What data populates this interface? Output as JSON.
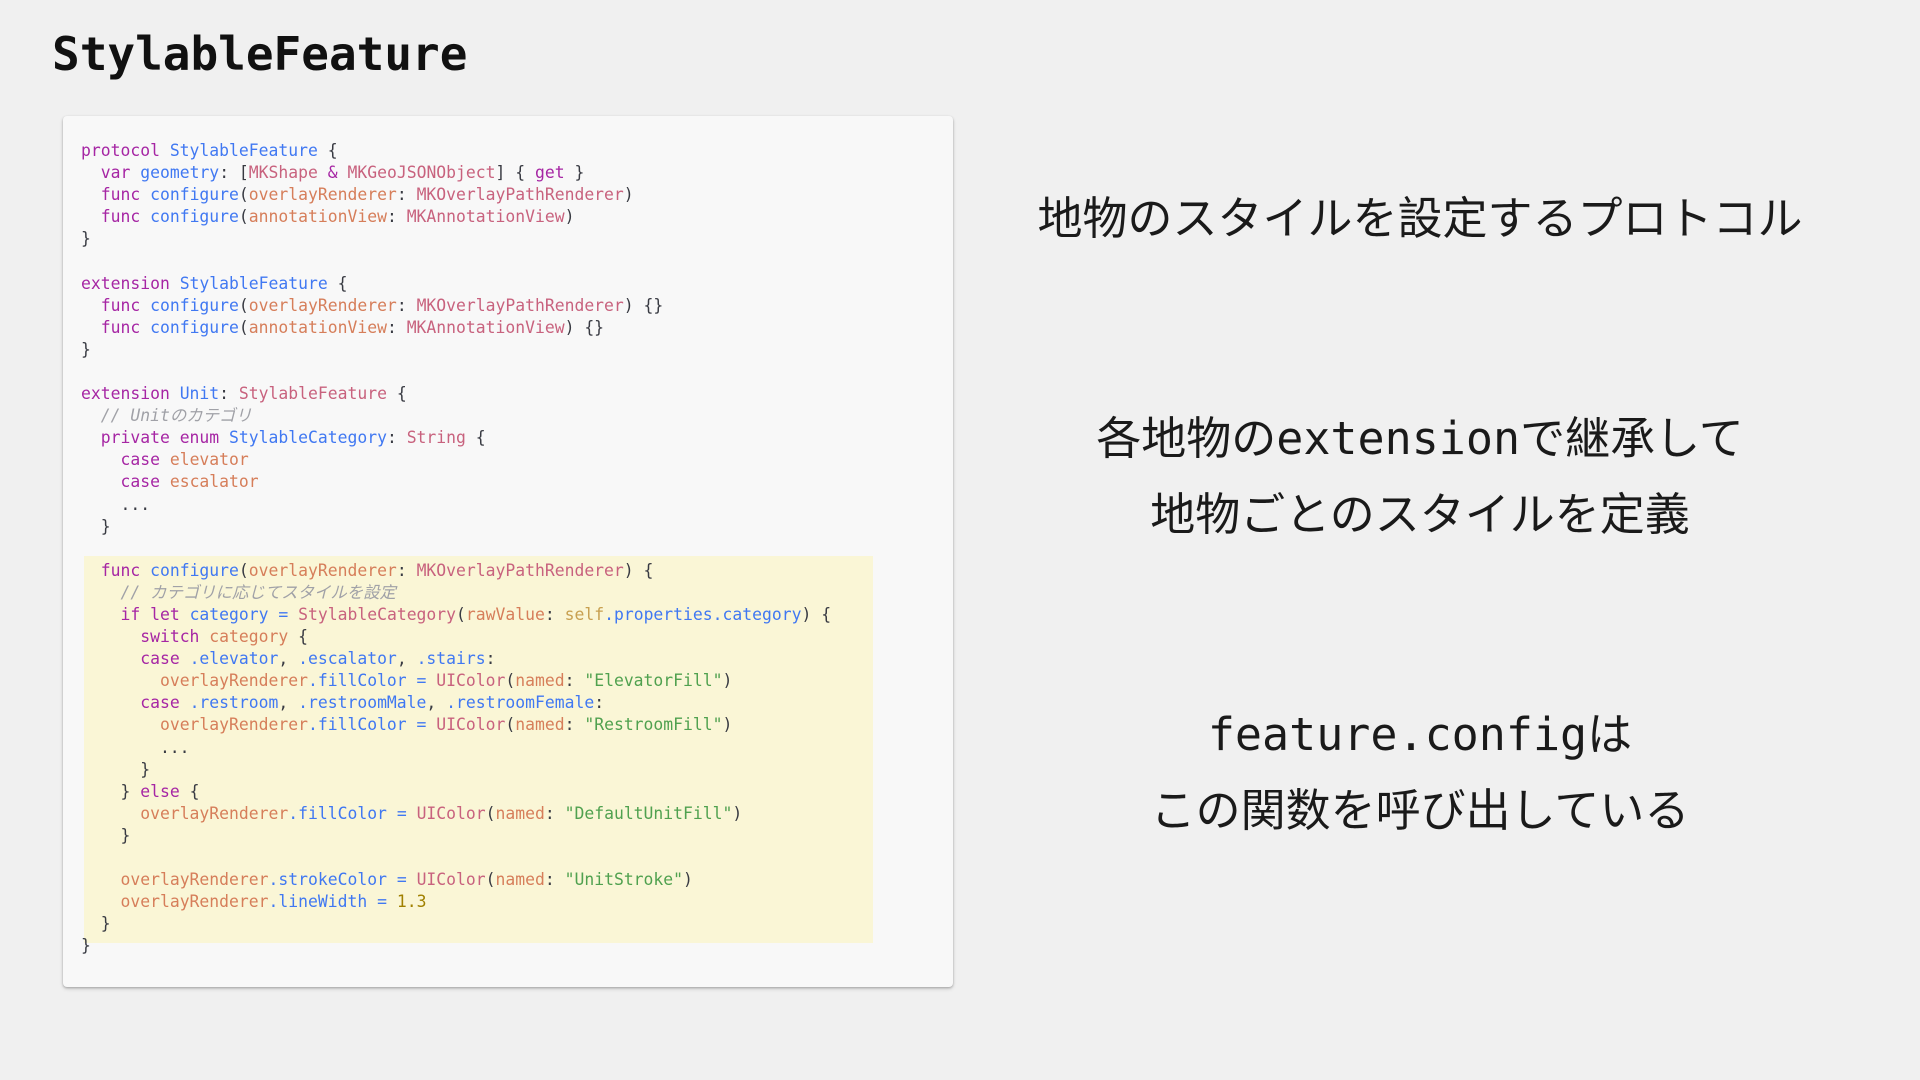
{
  "slide": {
    "title": "StylableFeature"
  },
  "captions": {
    "protocol": "地物のスタイルを設定するプロトコル",
    "extension_line1_code": "各地物のextensionで継承して",
    "extension_line2": "地物ごとのスタイルを定義",
    "config_line1_code": "feature.config",
    "config_line1_suffix": "は",
    "config_line2": "この関数を呼び出している"
  },
  "code": {
    "language": "swift",
    "highlighted_lines": "func configure(overlayRenderer:) block",
    "lines": [
      [
        [
          "kw",
          "protocol "
        ],
        [
          "fn",
          "StylableFeature"
        ],
        [
          "pl",
          " {"
        ]
      ],
      [
        [
          "pl",
          "  "
        ],
        [
          "kw",
          "var "
        ],
        [
          "fn",
          "geometry"
        ],
        [
          "pl",
          ": ["
        ],
        [
          "ty",
          "MKShape"
        ],
        [
          "pl",
          " "
        ],
        [
          "kw",
          "&"
        ],
        [
          "pl",
          " "
        ],
        [
          "ty",
          "MKGeoJSONObject"
        ],
        [
          "pl",
          "] { "
        ],
        [
          "kw",
          "get"
        ],
        [
          "pl",
          " }"
        ]
      ],
      [
        [
          "pl",
          "  "
        ],
        [
          "kw",
          "func "
        ],
        [
          "fn",
          "configure"
        ],
        [
          "pl",
          "("
        ],
        [
          "pr",
          "overlayRenderer"
        ],
        [
          "pl",
          ": "
        ],
        [
          "ty",
          "MKOverlayPathRenderer"
        ],
        [
          "pl",
          ")"
        ]
      ],
      [
        [
          "pl",
          "  "
        ],
        [
          "kw",
          "func "
        ],
        [
          "fn",
          "configure"
        ],
        [
          "pl",
          "("
        ],
        [
          "pr",
          "annotationView"
        ],
        [
          "pl",
          ": "
        ],
        [
          "ty",
          "MKAnnotationView"
        ],
        [
          "pl",
          ")"
        ]
      ],
      [
        [
          "pl",
          "}"
        ]
      ],
      [],
      [
        [
          "kw",
          "extension "
        ],
        [
          "fn",
          "StylableFeature"
        ],
        [
          "pl",
          " {"
        ]
      ],
      [
        [
          "pl",
          "  "
        ],
        [
          "kw",
          "func "
        ],
        [
          "fn",
          "configure"
        ],
        [
          "pl",
          "("
        ],
        [
          "pr",
          "overlayRenderer"
        ],
        [
          "pl",
          ": "
        ],
        [
          "ty",
          "MKOverlayPathRenderer"
        ],
        [
          "pl",
          ") {}"
        ]
      ],
      [
        [
          "pl",
          "  "
        ],
        [
          "kw",
          "func "
        ],
        [
          "fn",
          "configure"
        ],
        [
          "pl",
          "("
        ],
        [
          "pr",
          "annotationView"
        ],
        [
          "pl",
          ": "
        ],
        [
          "ty",
          "MKAnnotationView"
        ],
        [
          "pl",
          ") {}"
        ]
      ],
      [
        [
          "pl",
          "}"
        ]
      ],
      [],
      [
        [
          "kw",
          "extension "
        ],
        [
          "fn",
          "Unit"
        ],
        [
          "pl",
          ": "
        ],
        [
          "ty",
          "StylableFeature"
        ],
        [
          "pl",
          " {"
        ]
      ],
      [
        [
          "pl",
          "  "
        ],
        [
          "cm",
          "// Unitのカテゴリ"
        ]
      ],
      [
        [
          "pl",
          "  "
        ],
        [
          "kw",
          "private enum "
        ],
        [
          "fn",
          "StylableCategory"
        ],
        [
          "pl",
          ": "
        ],
        [
          "ty",
          "String"
        ],
        [
          "pl",
          " {"
        ]
      ],
      [
        [
          "pl",
          "    "
        ],
        [
          "kw",
          "case "
        ],
        [
          "pr",
          "elevator"
        ]
      ],
      [
        [
          "pl",
          "    "
        ],
        [
          "kw",
          "case "
        ],
        [
          "pr",
          "escalator"
        ]
      ],
      [
        [
          "pl",
          "    ..."
        ]
      ],
      [
        [
          "pl",
          "  }"
        ]
      ],
      [],
      [
        [
          "pl",
          "  "
        ],
        [
          "kw",
          "func "
        ],
        [
          "fn",
          "configure"
        ],
        [
          "pl",
          "("
        ],
        [
          "pr",
          "overlayRenderer"
        ],
        [
          "pl",
          ": "
        ],
        [
          "ty",
          "MKOverlayPathRenderer"
        ],
        [
          "pl",
          ") {"
        ]
      ],
      [
        [
          "pl",
          "    "
        ],
        [
          "cm",
          "// カテゴリに応じてスタイルを設定"
        ]
      ],
      [
        [
          "pl",
          "    "
        ],
        [
          "kw",
          "if let "
        ],
        [
          "fn",
          "category"
        ],
        [
          "pl",
          " "
        ],
        [
          "mb",
          "="
        ],
        [
          "pl",
          " "
        ],
        [
          "ty",
          "StylableCategory"
        ],
        [
          "pl",
          "("
        ],
        [
          "pr",
          "rawValue"
        ],
        [
          "pl",
          ": "
        ],
        [
          "sf",
          "self"
        ],
        [
          "mb",
          ".properties.category"
        ],
        [
          "pl",
          ") {"
        ]
      ],
      [
        [
          "pl",
          "      "
        ],
        [
          "kw",
          "switch "
        ],
        [
          "pr",
          "category"
        ],
        [
          "pl",
          " {"
        ]
      ],
      [
        [
          "pl",
          "      "
        ],
        [
          "kw",
          "case "
        ],
        [
          "mb",
          ".elevator"
        ],
        [
          "pl",
          ", "
        ],
        [
          "mb",
          ".escalator"
        ],
        [
          "pl",
          ", "
        ],
        [
          "mb",
          ".stairs"
        ],
        [
          "pl",
          ":"
        ]
      ],
      [
        [
          "pl",
          "        "
        ],
        [
          "pr",
          "overlayRenderer"
        ],
        [
          "mb",
          ".fillColor"
        ],
        [
          "pl",
          " "
        ],
        [
          "mb",
          "="
        ],
        [
          "pl",
          " "
        ],
        [
          "ty",
          "UIColor"
        ],
        [
          "pl",
          "("
        ],
        [
          "pr",
          "named"
        ],
        [
          "pl",
          ": "
        ],
        [
          "st",
          "\"ElevatorFill\""
        ],
        [
          "pl",
          ")"
        ]
      ],
      [
        [
          "pl",
          "      "
        ],
        [
          "kw",
          "case "
        ],
        [
          "mb",
          ".restroom"
        ],
        [
          "pl",
          ", "
        ],
        [
          "mb",
          ".restroomMale"
        ],
        [
          "pl",
          ", "
        ],
        [
          "mb",
          ".restroomFemale"
        ],
        [
          "pl",
          ":"
        ]
      ],
      [
        [
          "pl",
          "        "
        ],
        [
          "pr",
          "overlayRenderer"
        ],
        [
          "mb",
          ".fillColor"
        ],
        [
          "pl",
          " "
        ],
        [
          "mb",
          "="
        ],
        [
          "pl",
          " "
        ],
        [
          "ty",
          "UIColor"
        ],
        [
          "pl",
          "("
        ],
        [
          "pr",
          "named"
        ],
        [
          "pl",
          ": "
        ],
        [
          "st",
          "\"RestroomFill\""
        ],
        [
          "pl",
          ")"
        ]
      ],
      [
        [
          "pl",
          "        ..."
        ]
      ],
      [
        [
          "pl",
          "      }"
        ]
      ],
      [
        [
          "pl",
          "    } "
        ],
        [
          "kw",
          "else"
        ],
        [
          "pl",
          " {"
        ]
      ],
      [
        [
          "pl",
          "      "
        ],
        [
          "pr",
          "overlayRenderer"
        ],
        [
          "mb",
          ".fillColor"
        ],
        [
          "pl",
          " "
        ],
        [
          "mb",
          "="
        ],
        [
          "pl",
          " "
        ],
        [
          "ty",
          "UIColor"
        ],
        [
          "pl",
          "("
        ],
        [
          "pr",
          "named"
        ],
        [
          "pl",
          ": "
        ],
        [
          "st",
          "\"DefaultUnitFill\""
        ],
        [
          "pl",
          ")"
        ]
      ],
      [
        [
          "pl",
          "    }"
        ]
      ],
      [],
      [
        [
          "pl",
          "    "
        ],
        [
          "pr",
          "overlayRenderer"
        ],
        [
          "mb",
          ".strokeColor"
        ],
        [
          "pl",
          " "
        ],
        [
          "mb",
          "="
        ],
        [
          "pl",
          " "
        ],
        [
          "ty",
          "UIColor"
        ],
        [
          "pl",
          "("
        ],
        [
          "pr",
          "named"
        ],
        [
          "pl",
          ": "
        ],
        [
          "st",
          "\"UnitStroke\""
        ],
        [
          "pl",
          ")"
        ]
      ],
      [
        [
          "pl",
          "    "
        ],
        [
          "pr",
          "overlayRenderer"
        ],
        [
          "mb",
          ".lineWidth"
        ],
        [
          "pl",
          " "
        ],
        [
          "mb",
          "="
        ],
        [
          "pl",
          " "
        ],
        [
          "nm",
          "1.3"
        ]
      ],
      [
        [
          "pl",
          "  }"
        ]
      ],
      [
        [
          "pl",
          "}"
        ]
      ]
    ]
  },
  "colors": {
    "background": "#f0f0f0",
    "code_card": "#f8f8f8",
    "highlight": "#faf6d6",
    "keyword": "#a626a4",
    "function": "#4078f2",
    "type": "#c8627e",
    "property": "#d67e5a",
    "string": "#50a14f",
    "number": "#a08000",
    "comment": "#a0a1a7"
  }
}
